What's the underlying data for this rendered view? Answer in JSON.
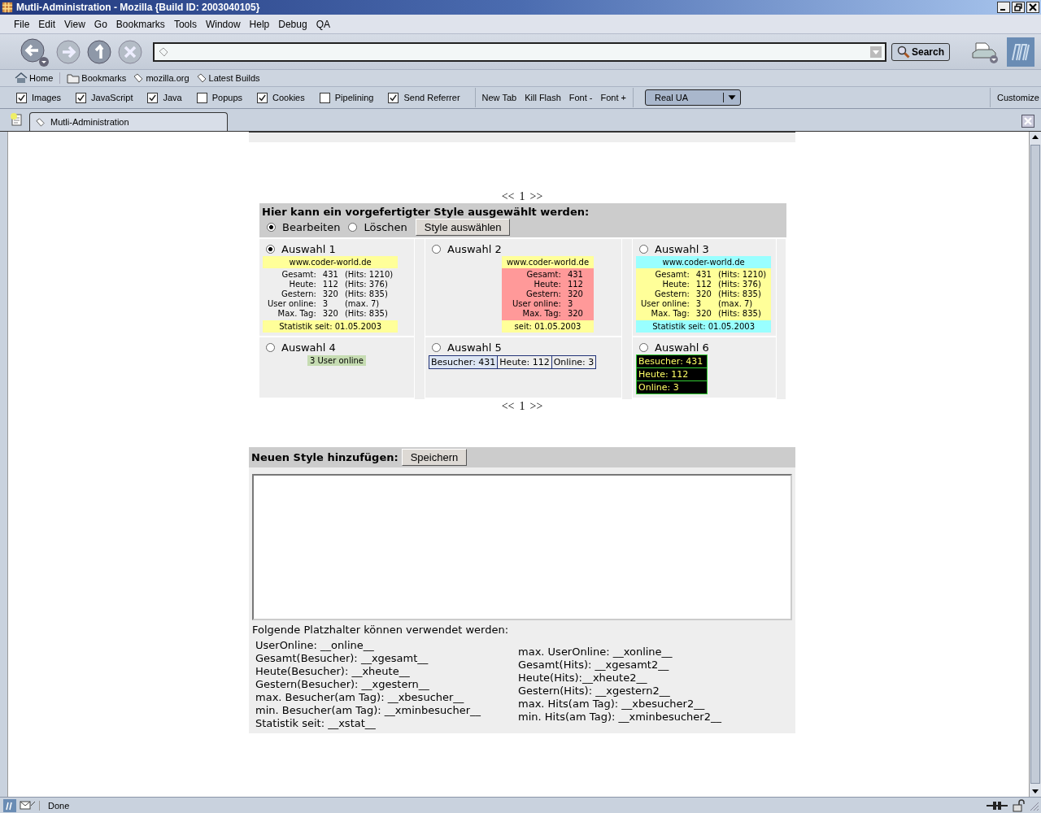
{
  "window": {
    "title": "Mutli-Administration - Mozilla {Build ID: 2003040105}"
  },
  "menu": [
    "File",
    "Edit",
    "View",
    "Go",
    "Bookmarks",
    "Tools",
    "Window",
    "Help",
    "Debug",
    "QA"
  ],
  "search_button": "Search",
  "personal_toolbar": [
    {
      "label": "Home",
      "kind": "home"
    },
    {
      "label": "Bookmarks",
      "kind": "folder"
    },
    {
      "label": "mozilla.org",
      "kind": "link"
    },
    {
      "label": "Latest Builds",
      "kind": "link"
    }
  ],
  "pref_checkboxes": [
    {
      "label": "Images",
      "checked": true
    },
    {
      "label": "JavaScript",
      "checked": true
    },
    {
      "label": "Java",
      "checked": true
    },
    {
      "label": "Popups",
      "checked": false
    },
    {
      "label": "Cookies",
      "checked": true
    },
    {
      "label": "Pipelining",
      "checked": false
    },
    {
      "label": "Send Referrer",
      "checked": true
    }
  ],
  "pref_buttons": [
    "New Tab",
    "Kill Flash",
    "Font -",
    "Font +"
  ],
  "ua_select": "Real UA",
  "customize": "Customize",
  "tabs": [
    {
      "label": "Mutli-Administration",
      "selected": true
    }
  ],
  "pager_top": {
    "prev": "<<",
    "page": "1",
    "next": ">>"
  },
  "style_panel": {
    "heading": "Hier kann ein vorgefertigter Style ausgewählt werden:",
    "modes": [
      {
        "label": "Bearbeiten",
        "selected": true
      },
      {
        "label": "Löschen",
        "selected": false
      }
    ],
    "button": "Style auswählen",
    "styles": [
      {
        "label": "Auswahl 1",
        "selected": true,
        "kind": "table",
        "header": {
          "text": "www.coder-world.de",
          "color": "#ffff99"
        },
        "stats": {
          "rows": [
            [
              "Gesamt:",
              "431",
              "(Hits: 1210)"
            ],
            [
              "Heute:",
              "112",
              "(Hits: 376)"
            ],
            [
              "Gestern:",
              "320",
              "(Hits: 835)"
            ],
            [
              "User online:",
              "3",
              "(max. 7)"
            ],
            [
              "Max. Tag:",
              "320",
              "(Hits: 835)"
            ]
          ]
        },
        "footer": {
          "text": "Statistik seit: 01.05.2003",
          "color": "#ffff99"
        }
      },
      {
        "label": "Auswahl 2",
        "selected": false,
        "kind": "table",
        "header": {
          "text": "www.coder-world.de",
          "color": "#ffff99"
        },
        "stats": {
          "color": "#ff9999",
          "rows": [
            [
              "Gesamt:",
              "431"
            ],
            [
              "Heute:",
              "112"
            ],
            [
              "Gestern:",
              "320"
            ],
            [
              "User online:",
              "3"
            ],
            [
              "Max. Tag:",
              "320"
            ]
          ]
        },
        "footer": {
          "text": "seit: 01.05.2003",
          "color": "#ffff99"
        }
      },
      {
        "label": "Auswahl 3",
        "selected": false,
        "kind": "table",
        "header": {
          "text": "www.coder-world.de",
          "color": "#99ffff"
        },
        "stats": {
          "color": "#ffff99",
          "rows": [
            [
              "Gesamt:",
              "431",
              "(Hits: 1210)"
            ],
            [
              "Heute:",
              "112",
              "(Hits: 376)"
            ],
            [
              "Gestern:",
              "320",
              "(Hits: 835)"
            ],
            [
              "User online:",
              "3",
              "(max. 7)"
            ],
            [
              "Max. Tag:",
              "320",
              "(Hits: 835)"
            ]
          ]
        },
        "footer": {
          "text": "Statistik seit: 01.05.2003",
          "color": "#99ffff"
        }
      },
      {
        "label": "Auswahl 4",
        "selected": false,
        "kind": "badge",
        "text": "3 User online"
      },
      {
        "label": "Auswahl 5",
        "selected": false,
        "kind": "inline",
        "cells": [
          "Besucher: 431",
          "Heute: 112",
          "Online: 3"
        ]
      },
      {
        "label": "Auswahl 6",
        "selected": false,
        "kind": "stack",
        "cells": [
          "Besucher: 431",
          "Heute: 112",
          "Online: 3"
        ]
      }
    ]
  },
  "pager_bottom": {
    "prev": "<<",
    "page": "1",
    "next": ">>"
  },
  "add_panel": {
    "heading": "Neuen Style hinzufügen:",
    "button": "Speichern",
    "hint": "Folgende Platzhalter können verwendet werden:",
    "placeholders_left": [
      "UserOnline: __online__",
      "Gesamt(Besucher): __xgesamt__",
      "Heute(Besucher): __xheute__",
      "Gestern(Besucher): __xgestern__",
      "max. Besucher(am Tag): __xbesucher__",
      "min. Besucher(am Tag): __xminbesucher__",
      "Statistik seit: __xstat__"
    ],
    "placeholders_right": [
      "max. UserOnline: __xonline__",
      "Gesamt(Hits): __xgesamt2__",
      "Heute(Hits):__xheute2__",
      "Gestern(Hits): __xgestern2__",
      "max. Hits(am Tag): __xbesucher2__",
      "min. Hits(am Tag): __xminbesucher2__"
    ]
  },
  "status_bar": {
    "text": "Done"
  }
}
